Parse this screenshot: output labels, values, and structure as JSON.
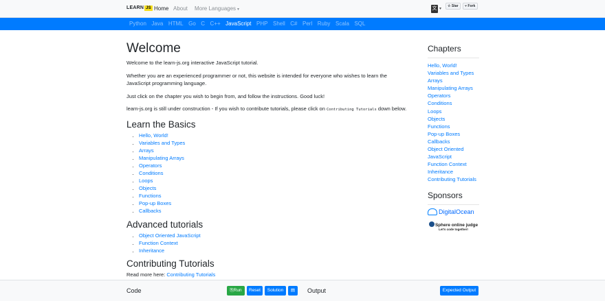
{
  "navbar": {
    "logo_text": "LEARN",
    "logo_badge": "JS",
    "home": "Home",
    "about": "About",
    "more_languages": "More Languages",
    "github_star": "Star",
    "github_fork": "Fork"
  },
  "languages": [
    "Python",
    "Java",
    "HTML",
    "Go",
    "C",
    "C++",
    "JavaScript",
    "PHP",
    "Shell",
    "C#",
    "Perl",
    "Ruby",
    "Scala",
    "SQL"
  ],
  "active_language": "JavaScript",
  "main": {
    "title": "Welcome",
    "p1": "Welcome to the learn-js.org interactive JavaScript tutorial.",
    "p2": "Whether you are an experienced programmer or not, this website is intended for everyone who wishes to learn the JavaScript programming language.",
    "p3": "Just click on the chapter you wish to begin from, and follow the instructions. Good luck!",
    "p4_before": "learn-js.org is still under construction - If you wish to contribute tutorials, please click on ",
    "p4_code": "Contributing Tutorials",
    "p4_after": " down below.",
    "basics_heading": "Learn the Basics",
    "basics": [
      "Hello, World!",
      "Variables and Types",
      "Arrays",
      "Manipulating Arrays",
      "Operators",
      "Conditions",
      "Loops",
      "Objects",
      "Functions",
      "Pop-up Boxes",
      "Callbacks"
    ],
    "advanced_heading": "Advanced tutorials",
    "advanced": [
      "Object Oriented JavaScript",
      "Function Context",
      "Inheritance"
    ],
    "contrib_heading": "Contributing Tutorials",
    "read_more": "Read more here: ",
    "read_more_link": "Contributing Tutorials"
  },
  "sidebar": {
    "chapters_heading": "Chapters",
    "chapters": [
      "Hello, World!",
      "Variables and Types",
      "Arrays",
      "Manipulating Arrays",
      "Operators",
      "Conditions",
      "Loops",
      "Objects",
      "Functions",
      "Pop-up Boxes",
      "Callbacks",
      "Object Oriented JavaScript",
      "Function Context",
      "Inheritance",
      "Contributing Tutorials"
    ],
    "sponsors_heading": "Sponsors",
    "sponsor1": "DigitalOcean",
    "sponsor2_title": "Sphere online judge",
    "sponsor2_tag": "Let's code together!"
  },
  "bottom": {
    "code_label": "Code",
    "run": "Run",
    "reset": "Reset",
    "solution": "Solution",
    "output_label": "Output",
    "expected_output": "Expected Output"
  },
  "colors": {
    "primary": "#007bff",
    "success": "#28a745",
    "navbar_bg": "#f8f9fa"
  }
}
